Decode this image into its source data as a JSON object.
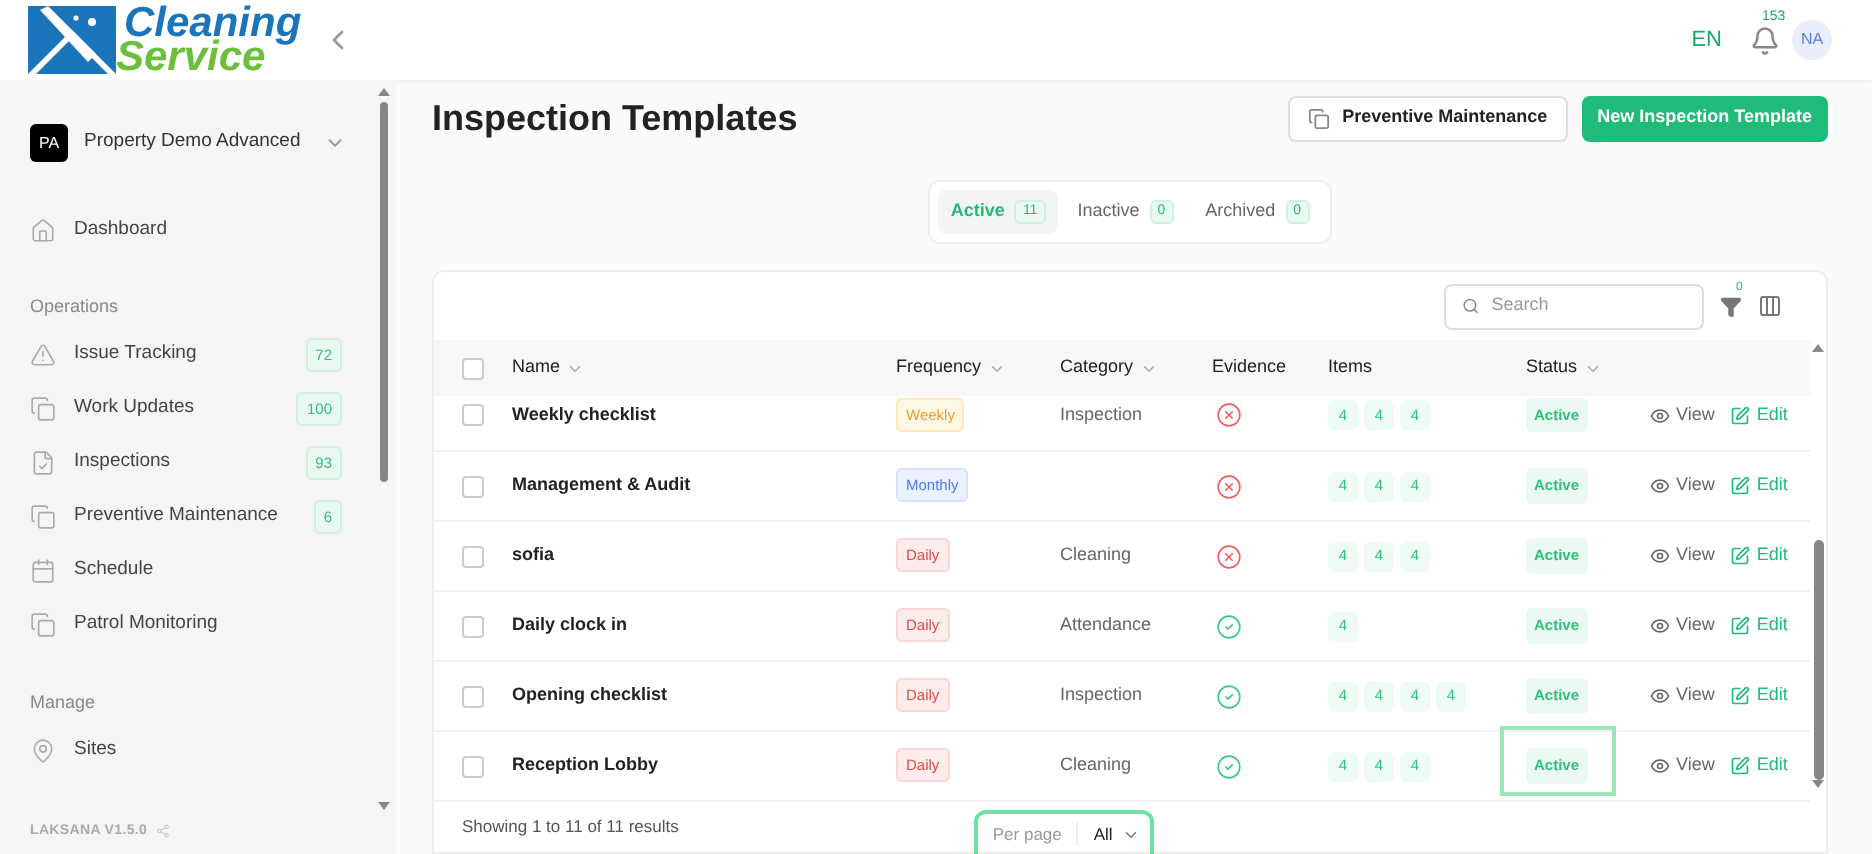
{
  "header": {
    "logo_line1": "Cleaning",
    "logo_line2": "Service",
    "language": "EN",
    "notification_count": "153",
    "avatar": "NA"
  },
  "sidebar": {
    "property": {
      "initials": "PA",
      "name": "Property Demo Advanced"
    },
    "sections": [
      {
        "items": [
          {
            "label": "Dashboard"
          }
        ]
      },
      {
        "title": "Operations",
        "items": [
          {
            "label": "Issue Tracking",
            "count": "72"
          },
          {
            "label": "Work Updates",
            "count": "100"
          },
          {
            "label": "Inspections",
            "count": "93"
          },
          {
            "label": "Preventive Maintenance",
            "count": "6"
          },
          {
            "label": "Schedule"
          },
          {
            "label": "Patrol Monitoring"
          }
        ]
      },
      {
        "title": "Manage",
        "items": [
          {
            "label": "Sites"
          }
        ]
      }
    ],
    "version": "LAKSANA V1.5.0"
  },
  "page": {
    "title": "Inspection Templates",
    "secondary_button": "Preventive Maintenance",
    "primary_button": "New Inspection Template"
  },
  "tabs": [
    {
      "label": "Active",
      "count": "11",
      "selected": true
    },
    {
      "label": "Inactive",
      "count": "0",
      "selected": false
    },
    {
      "label": "Archived",
      "count": "0",
      "selected": false
    }
  ],
  "toolbar": {
    "search_placeholder": "Search",
    "filter_count": "0"
  },
  "table": {
    "select_all_checked": false,
    "columns": [
      "Name",
      "Frequency",
      "Category",
      "Evidence",
      "Items",
      "Status"
    ],
    "rows": [
      {
        "checked": false,
        "name": "Weekly checklist",
        "frequency": {
          "label": "Weekly",
          "kind": "weekly"
        },
        "category": "Inspection",
        "evidence": false,
        "items": [
          "4",
          "4",
          "4"
        ],
        "status": "Active",
        "focused": false,
        "view": "View",
        "edit": "Edit"
      },
      {
        "checked": false,
        "name": "Management & Audit",
        "frequency": {
          "label": "Monthly",
          "kind": "monthly"
        },
        "evidence": false,
        "items": [
          "4",
          "4",
          "4"
        ],
        "status": "Active",
        "focused": false,
        "view": "View",
        "edit": "Edit"
      },
      {
        "checked": false,
        "name": "sofia",
        "frequency": {
          "label": "Daily",
          "kind": "daily"
        },
        "category": "Cleaning",
        "evidence": false,
        "items": [
          "4",
          "4",
          "4"
        ],
        "status": "Active",
        "focused": false,
        "view": "View",
        "edit": "Edit"
      },
      {
        "checked": false,
        "name": "Daily clock in",
        "frequency": {
          "label": "Daily",
          "kind": "daily"
        },
        "category": "Attendance",
        "evidence": true,
        "items": [
          "4"
        ],
        "status": "Active",
        "focused": false,
        "view": "View",
        "edit": "Edit"
      },
      {
        "checked": false,
        "name": "Opening checklist",
        "frequency": {
          "label": "Daily",
          "kind": "daily"
        },
        "category": "Inspection",
        "evidence": true,
        "items": [
          "4",
          "4",
          "4",
          "4"
        ],
        "status": "Active",
        "focused": false,
        "view": "View",
        "edit": "Edit"
      },
      {
        "checked": false,
        "name": "Reception Lobby",
        "frequency": {
          "label": "Daily",
          "kind": "daily"
        },
        "category": "Cleaning",
        "evidence": true,
        "items": [
          "4",
          "4",
          "4"
        ],
        "status": "Active",
        "focused": true,
        "view": "View",
        "edit": "Edit"
      }
    ]
  },
  "footer": {
    "summary": "Showing 1 to 11 of 11 results",
    "per_page_label": "Per page",
    "per_page_value": "All"
  }
}
